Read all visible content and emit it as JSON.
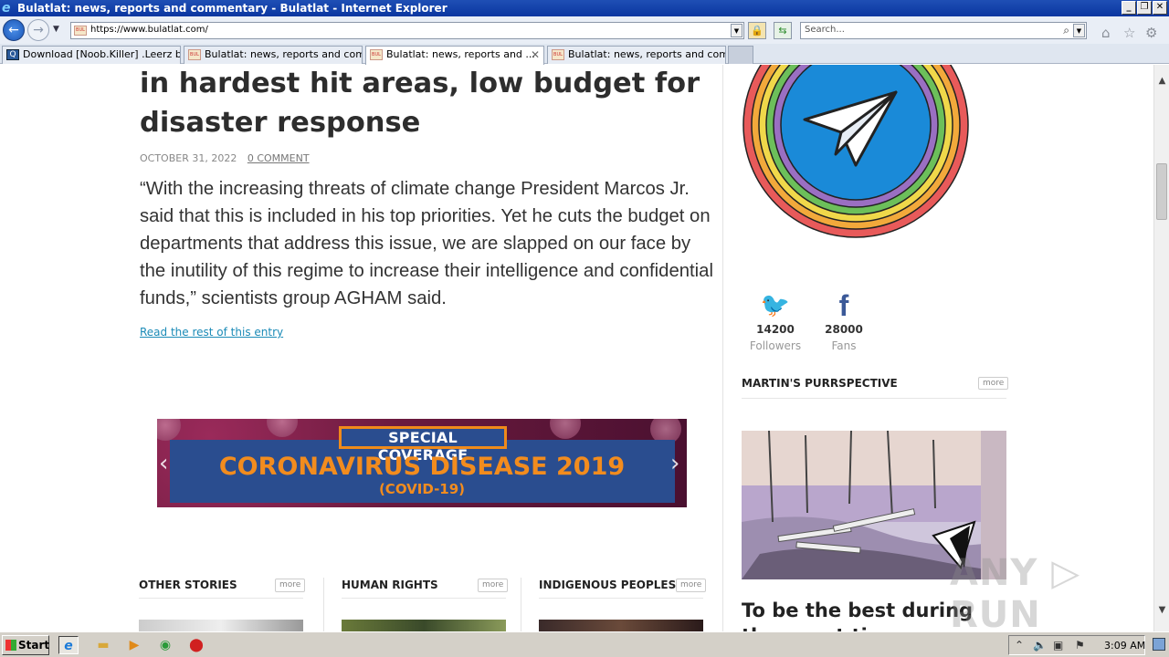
{
  "window": {
    "title": "Bulatlat: news, reports and commentary - Bulatlat - Internet Explorer",
    "minimize": "_",
    "restore": "❐",
    "close": "✕"
  },
  "address_bar": {
    "url": "https://www.bulatlat.com/",
    "search_placeholder": "Search..."
  },
  "tabs": [
    {
      "label": "Download [Noob.Killer] .Leerz b...",
      "active": false
    },
    {
      "label": "Bulatlat: news, reports and com...",
      "active": false
    },
    {
      "label": "Bulatlat: news, reports and ...",
      "active": true
    },
    {
      "label": "Bulatlat: news, reports and com...",
      "active": false
    }
  ],
  "article": {
    "headline": "in hardest hit areas, low budget for disaster response",
    "date": "OCTOBER 31, 2022",
    "comments": "0 COMMENT",
    "excerpt": "“With the increasing threats of climate change President Marcos Jr. said that this is included in his top priorities. Yet he cuts the budget on departments that address this issue, we are slapped on our face by the inutility of this regime to increase their intelligence and confidential funds,” scientists group AGHAM said.",
    "read_more": "Read the rest of this entry"
  },
  "banner": {
    "tag": "SPECIAL COVERAGE",
    "title": "CORONAVIRUS DISEASE 2019",
    "subtitle": "(COVID-19)"
  },
  "sections": [
    {
      "title": "OTHER STORIES",
      "more": "more"
    },
    {
      "title": "HUMAN RIGHTS",
      "more": "more"
    },
    {
      "title": "INDIGENOUS PEOPLES",
      "more": "more"
    }
  ],
  "sidebar": {
    "twitter": {
      "count": "14200",
      "label": "Followers"
    },
    "facebook": {
      "count": "28000",
      "label": "Fans"
    },
    "section_title": "MARTIN'S PURRSPECTIVE",
    "section_more": "more",
    "story_title": "To be the best during the worst times"
  },
  "watermark": "ANY ▷ RUN",
  "taskbar": {
    "start": "Start",
    "clock": "3:09 AM"
  },
  "colors": {
    "link": "#1b8bb7",
    "banner_orange": "#f28c1e",
    "banner_blue": "#2a4d8f",
    "twitter": "#1da1f2",
    "facebook": "#3b5998"
  }
}
